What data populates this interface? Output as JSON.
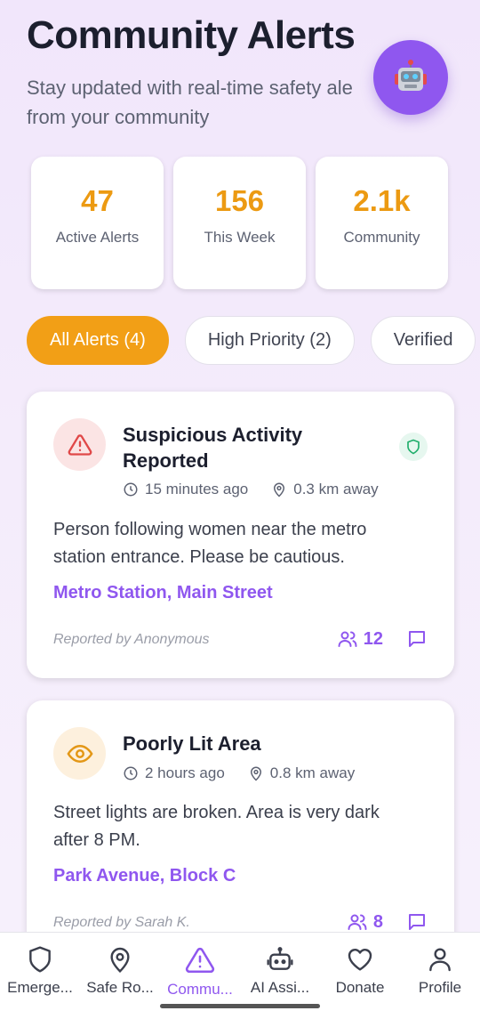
{
  "header": {
    "title": "Community Alerts",
    "subtitle_line1": "Stay updated with real-time safety ale",
    "subtitle_line2": "from your community"
  },
  "ai_button": {
    "icon": "robot-icon"
  },
  "stats": [
    {
      "value": "47",
      "label": "Active Alerts"
    },
    {
      "value": "156",
      "label": "This Week"
    },
    {
      "value": "2.1k",
      "label": "Community"
    }
  ],
  "filters": [
    {
      "label": "All Alerts (4)",
      "active": true
    },
    {
      "label": "High Priority (2)",
      "active": false
    },
    {
      "label": "Verified",
      "active": false
    }
  ],
  "alerts": [
    {
      "title_line1": "Suspicious Activity",
      "title_line2": "Reported",
      "time": "15 minutes ago",
      "distance": "0.3 km away",
      "description_line1": "Person following women near the metro",
      "description_line2": "station entrance. Please be cautious.",
      "location": "Metro Station, Main Street",
      "reporter": "Reported by Anonymous",
      "supporters": "12",
      "icon": "warning-triangle-icon",
      "verified": true
    },
    {
      "title_line1": "Poorly Lit Area",
      "time": "2 hours ago",
      "distance": "0.8 km away",
      "description_line1": "Street lights are broken. Area is very dark",
      "description_line2": "after 8 PM.",
      "location": "Park Avenue, Block C",
      "reporter": "Reported by Sarah K.",
      "supporters": "8",
      "icon": "eye-icon"
    }
  ],
  "nav": [
    {
      "label": "Emerge...",
      "icon": "shield-icon"
    },
    {
      "label": "Safe Ro...",
      "icon": "map-pin-icon"
    },
    {
      "label": "Commu...",
      "icon": "alert-triangle-icon",
      "active": true
    },
    {
      "label": "AI Assi...",
      "icon": "robot-icon"
    },
    {
      "label": "Donate",
      "icon": "heart-icon"
    },
    {
      "label": "Profile",
      "icon": "user-icon"
    }
  ],
  "colors": {
    "accent_purple": "#8f57ef",
    "accent_orange": "#f29f16",
    "danger_red": "#e04848",
    "verified_green": "#1fae6b"
  }
}
